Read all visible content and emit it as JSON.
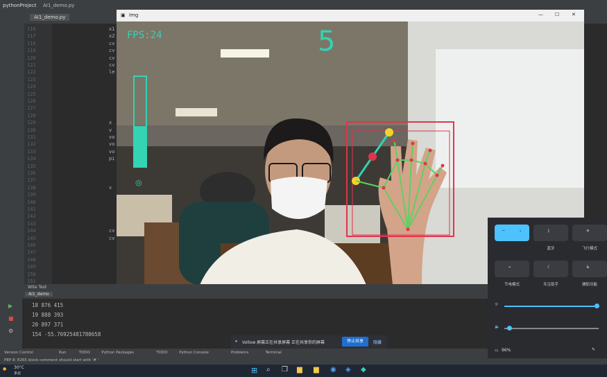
{
  "ide": {
    "project_title": "pythonProject",
    "file_tab_crumb": "AI1_demo.py",
    "editor_tab": "AI1_demo.py",
    "line_numbers": [
      "116",
      "117",
      "118",
      "119",
      "120",
      "121",
      "122",
      "123",
      "124",
      "125",
      "126",
      "127",
      "128",
      "129",
      "130",
      "131",
      "132",
      "133",
      "134",
      "135",
      "136",
      "137",
      "138",
      "139",
      "140",
      "141",
      "142",
      "143",
      "144",
      "145",
      "146",
      "147",
      "148",
      "149",
      "150",
      "151"
    ],
    "code_snippets": [
      "x1",
      "x2",
      "cv",
      "cv",
      "cv",
      "cv",
      "le",
      "x",
      "v",
      "vo",
      "vo",
      "vo",
      "pi",
      "v",
      "cv",
      "cv"
    ],
    "run_header": "Wite Test",
    "run_tab": "AI1_demo",
    "console_lines": [
      "18 876 415",
      "19 888 393",
      "20 897 371",
      "154 -55.76925481780658"
    ],
    "bottom_tabs": [
      "Version Control",
      "Run",
      "TODO",
      "Python Packages",
      "TODO",
      "Python Console",
      "Problems",
      "Terminal"
    ],
    "status_text": "PEP 8: E265 block comment should start with '# '"
  },
  "camera": {
    "window_title": "Img",
    "fps_label": "FPS:24",
    "finger_count": "5",
    "volume_level_percent": 45
  },
  "notification": {
    "text": "Vollow 屏幕正在共享屏幕 正在共享你的屏幕",
    "stop_button": "停止共享",
    "hide_button": "隐藏"
  },
  "quick_settings": {
    "tiles": [
      "",
      "蓝牙",
      "飞行模式",
      "节电模式",
      "专注助手",
      "辅助功能"
    ],
    "brightness_percent": 95,
    "volume_percent": 8,
    "battery": "96%"
  },
  "taskbar": {
    "weather": "30°C",
    "weather_sub": "多云"
  },
  "colors": {
    "teal": "#33d3b3",
    "accent_blue": "#4cc2ff",
    "hand_box": "#e0344e"
  }
}
